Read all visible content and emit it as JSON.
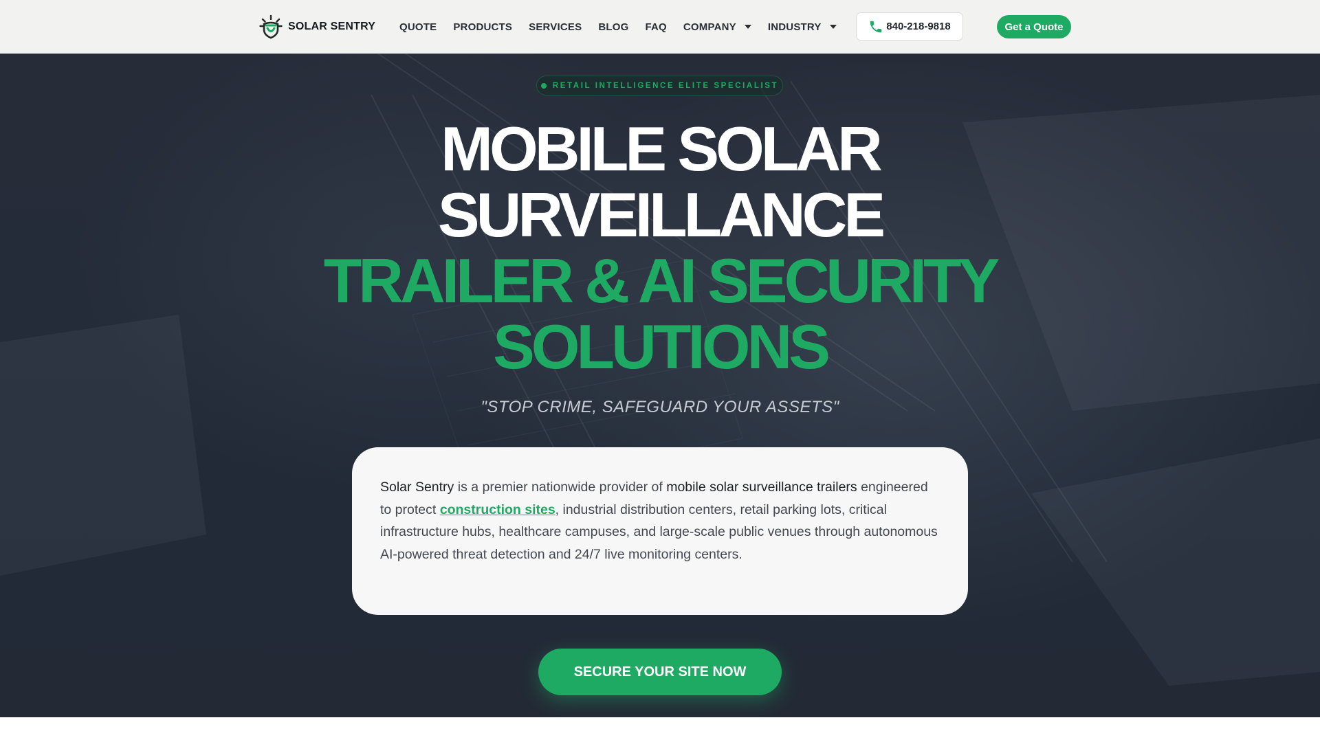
{
  "brand": {
    "name": "SOLAR SENTRY",
    "logo_icon": "solar-shield-logo-icon",
    "accent_color": "#1faa63"
  },
  "nav": {
    "items": [
      {
        "label": "QUOTE",
        "dropdown": false
      },
      {
        "label": "PRODUCTS",
        "dropdown": false
      },
      {
        "label": "SERVICES",
        "dropdown": false
      },
      {
        "label": "BLOG",
        "dropdown": false
      },
      {
        "label": "FAQ",
        "dropdown": false
      },
      {
        "label": "COMPANY",
        "dropdown": true
      },
      {
        "label": "INDUSTRY",
        "dropdown": true
      }
    ],
    "phone": "840-218-9818",
    "phone_icon": "phone-icon",
    "quote_button": "Get a Quote"
  },
  "hero": {
    "badge": "RETAIL INTELLIGENCE ELITE SPECIALIST",
    "headline_white": [
      "MOBILE SOLAR",
      "SURVEILLANCE"
    ],
    "headline_green": [
      "TRAILER & AI SECURITY",
      "SOLUTIONS"
    ],
    "tagline": "\"STOP CRIME, SAFEGUARD YOUR ASSETS\"",
    "intro": {
      "brand": "Solar Sentry",
      "text_1": " is a premier nationwide provider of ",
      "highlight": "mobile solar surveillance trailers",
      "text_2": " engineered to protect ",
      "link": "construction sites",
      "text_3": ", industrial distribution centers, retail parking lots, critical infrastructure hubs, healthcare campuses, and large-scale public venues through autonomous AI-powered threat detection and 24/7 live monitoring centers."
    },
    "cta": "SECURE YOUR SITE NOW"
  }
}
